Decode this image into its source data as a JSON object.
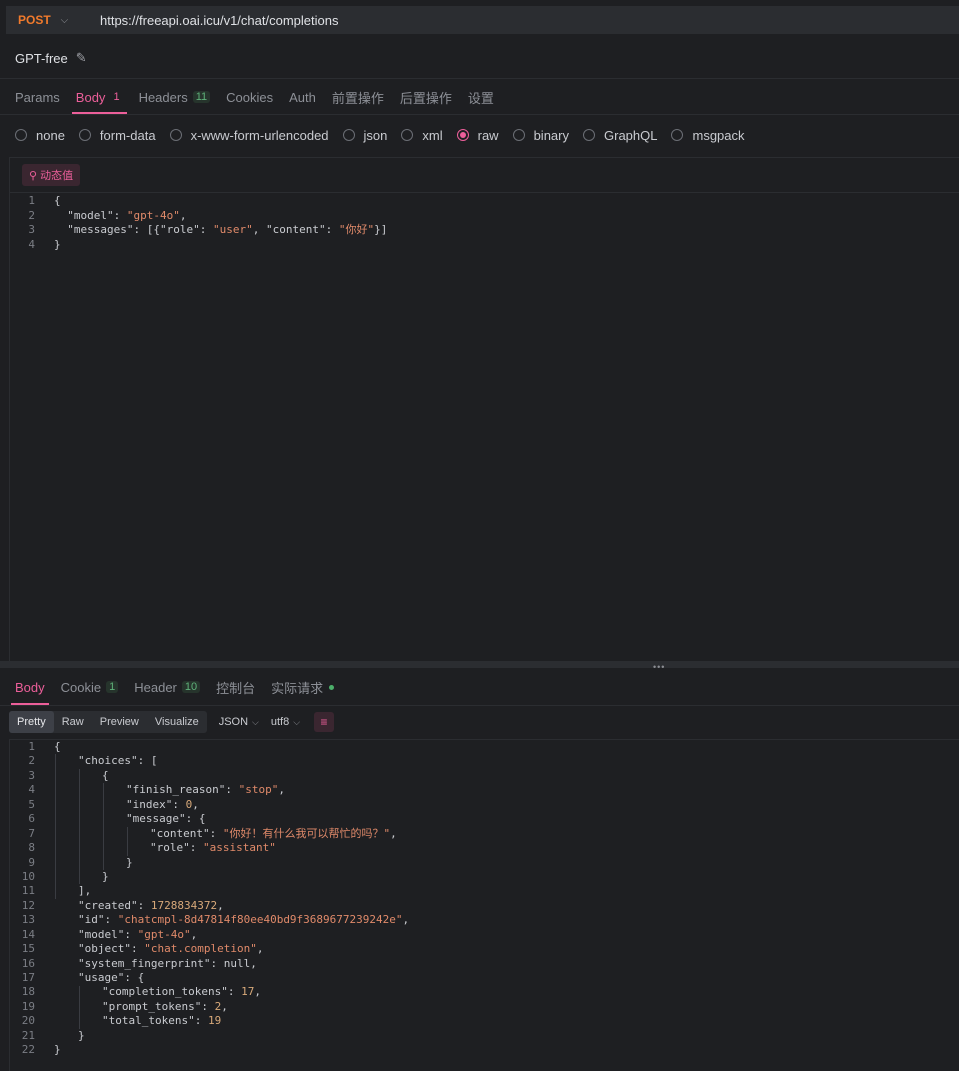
{
  "request": {
    "method": "POST",
    "url": "https://freeapi.oai.icu/v1/chat/completions",
    "name": "GPT-free"
  },
  "request_tabs": [
    {
      "label": "Params",
      "badge": ""
    },
    {
      "label": "Body",
      "badge": "1",
      "active": true
    },
    {
      "label": "Headers",
      "badge": "11"
    },
    {
      "label": "Cookies",
      "badge": ""
    },
    {
      "label": "Auth",
      "badge": ""
    },
    {
      "label": "前置操作",
      "badge": ""
    },
    {
      "label": "后置操作",
      "badge": ""
    },
    {
      "label": "设置",
      "badge": ""
    }
  ],
  "body_types": [
    {
      "label": "none"
    },
    {
      "label": "form-data"
    },
    {
      "label": "x-www-form-urlencoded"
    },
    {
      "label": "json"
    },
    {
      "label": "xml"
    },
    {
      "label": "raw",
      "selected": true
    },
    {
      "label": "binary"
    },
    {
      "label": "GraphQL"
    },
    {
      "label": "msgpack"
    }
  ],
  "dynamic_value_label": "动态值",
  "request_body_lines": [
    "{",
    "  \"model\": \"gpt-4o\",",
    "  \"messages\": [{\"role\": \"user\", \"content\": \"你好\"}]",
    "}"
  ],
  "response_tabs": [
    {
      "label": "Body",
      "badge": "",
      "active": true
    },
    {
      "label": "Cookie",
      "badge": "1"
    },
    {
      "label": "Header",
      "badge": "10"
    },
    {
      "label": "控制台",
      "badge": ""
    },
    {
      "label": "实际请求",
      "badge": "",
      "dot": true
    }
  ],
  "view_modes": [
    "Pretty",
    "Raw",
    "Preview",
    "Visualize"
  ],
  "active_view_mode": "Pretty",
  "format": "JSON",
  "encoding": "utf8",
  "response_lines": [
    [
      0,
      "{"
    ],
    [
      1,
      "\"choices\": ["
    ],
    [
      2,
      "{"
    ],
    [
      3,
      "\"finish_reason\": \"stop\","
    ],
    [
      3,
      "\"index\": 0,"
    ],
    [
      3,
      "\"message\": {"
    ],
    [
      4,
      "\"content\": \"你好！有什么我可以帮忙的吗？\","
    ],
    [
      4,
      "\"role\": \"assistant\""
    ],
    [
      3,
      "}"
    ],
    [
      2,
      "}"
    ],
    [
      1,
      "],"
    ],
    [
      1,
      "\"created\": 1728834372,"
    ],
    [
      1,
      "\"id\": \"chatcmpl-8d47814f80ee40bd9f3689677239242e\","
    ],
    [
      1,
      "\"model\": \"gpt-4o\","
    ],
    [
      1,
      "\"object\": \"chat.completion\","
    ],
    [
      1,
      "\"system_fingerprint\": null,"
    ],
    [
      1,
      "\"usage\": {"
    ],
    [
      2,
      "\"completion_tokens\": 17,"
    ],
    [
      2,
      "\"prompt_tokens\": 2,"
    ],
    [
      2,
      "\"total_tokens\": 19"
    ],
    [
      1,
      "}"
    ],
    [
      0,
      "}"
    ]
  ],
  "colors": {
    "accent": "#ec5f9a",
    "method": "#f07a2c",
    "string": "#e08a6a",
    "number": "#d8a97a"
  }
}
